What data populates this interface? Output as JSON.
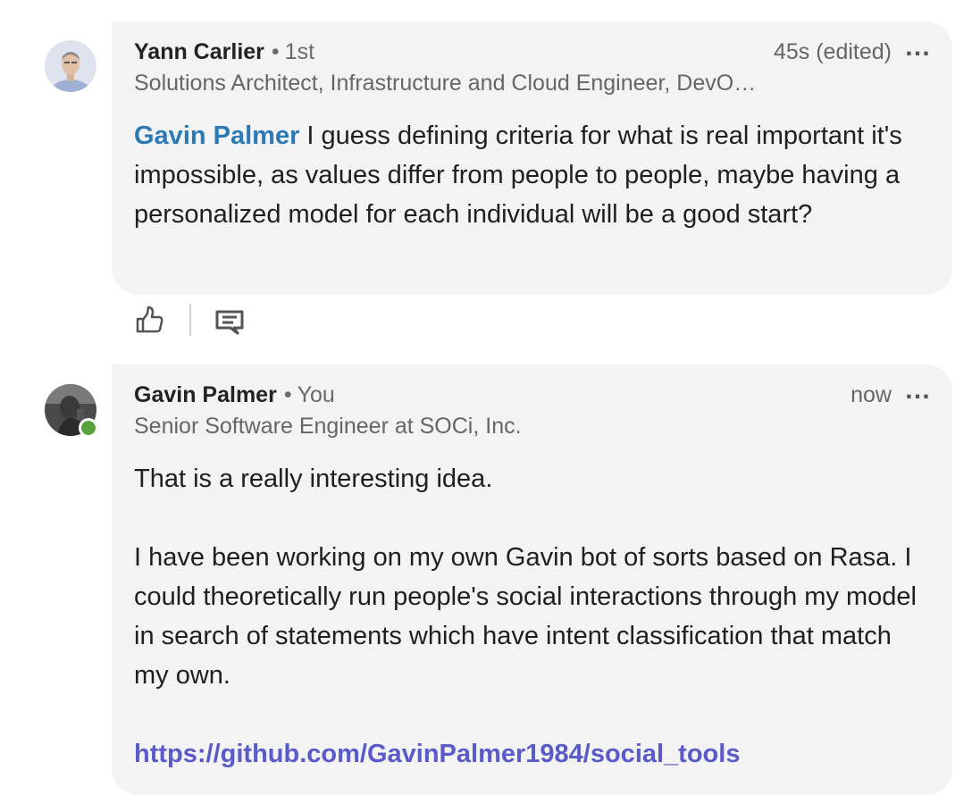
{
  "comments": [
    {
      "author": "Yann Carlier",
      "separator": "•",
      "degree": "1st",
      "headline": "Solutions Architect, Infrastructure and Cloud Engineer, DevO…",
      "timestamp": "45s (edited)",
      "more": "…",
      "mention": "Gavin Palmer",
      "text": " I guess defining criteria for what is real important it's impossible, as values differ from people to people, maybe having a personalized model for each individual will be a good start?"
    },
    {
      "author": "Gavin Palmer",
      "separator": "•",
      "degree": "You",
      "headline": "Senior Software Engineer at SOCi, Inc.",
      "timestamp": "now",
      "more": "…",
      "paragraph_1": "That is a really interesting idea.",
      "paragraph_2": "I have been working on my own Gavin bot of sorts based on Rasa.  I could theoretically run people's social interactions through my model in search of statements which have intent classification that match my own.",
      "link": "https://github.com/GavinPalmer1984/social_tools"
    }
  ],
  "actions": {
    "like_icon": "thumbs-up-icon",
    "reply_icon": "comment-icon"
  },
  "colors": {
    "bubble": "#f3f3f4",
    "mention": "#2b7ab5",
    "link": "#5a5ac8",
    "presence": "#57a13a"
  }
}
